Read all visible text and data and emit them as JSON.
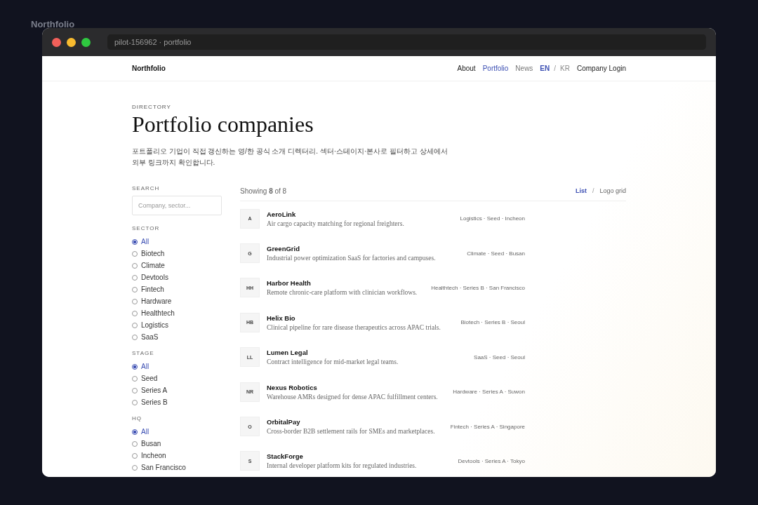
{
  "desktop_label": "Northfolio",
  "window": {
    "address": "pilot-156962 · portfolio"
  },
  "nav": {
    "brand": "Northfolio",
    "links": [
      {
        "label": "About",
        "selected": false
      },
      {
        "label": "Portfolio",
        "selected": true
      },
      {
        "label": "News",
        "selected": false
      }
    ],
    "languages": [
      {
        "label": "EN",
        "selected": true
      },
      {
        "label": "KR",
        "selected": false
      }
    ],
    "language_separator": "/",
    "login": "Company Login"
  },
  "header": {
    "eyebrow": "DIRECTORY",
    "title": "Portfolio companies",
    "description": "포트폴리오 기업이 직접 갱신하는 영/한 공식 소개 디렉터리. 섹터·스테이지·본사로 필터하고 상세에서 외부 링크까지 확인합니다."
  },
  "search": {
    "label": "SEARCH",
    "placeholder": "Company, sector..."
  },
  "filters": [
    {
      "label": "SECTOR",
      "options": [
        {
          "label": "All",
          "selected": true
        },
        {
          "label": "Biotech",
          "selected": false
        },
        {
          "label": "Climate",
          "selected": false
        },
        {
          "label": "Devtools",
          "selected": false
        },
        {
          "label": "Fintech",
          "selected": false
        },
        {
          "label": "Hardware",
          "selected": false
        },
        {
          "label": "Healthtech",
          "selected": false
        },
        {
          "label": "Logistics",
          "selected": false
        },
        {
          "label": "SaaS",
          "selected": false
        }
      ]
    },
    {
      "label": "STAGE",
      "options": [
        {
          "label": "All",
          "selected": true
        },
        {
          "label": "Seed",
          "selected": false
        },
        {
          "label": "Series A",
          "selected": false
        },
        {
          "label": "Series B",
          "selected": false
        }
      ]
    },
    {
      "label": "HQ",
      "options": [
        {
          "label": "All",
          "selected": true
        },
        {
          "label": "Busan",
          "selected": false
        },
        {
          "label": "Incheon",
          "selected": false
        },
        {
          "label": "San Francisco",
          "selected": false
        }
      ]
    }
  ],
  "results": {
    "summary": "Showing **8** of 8",
    "views": [
      {
        "label": "List",
        "selected": true
      },
      {
        "label": "Logo grid",
        "selected": false
      }
    ],
    "view_separator": "/"
  },
  "companies": [
    {
      "initials": "A",
      "name": "AeroLink",
      "description": "Air cargo capacity matching for regional freighters.",
      "meta": "Logistics · Seed · Incheon"
    },
    {
      "initials": "G",
      "name": "GreenGrid",
      "description": "Industrial power optimization SaaS for factories and campuses.",
      "meta": "Climate · Seed · Busan"
    },
    {
      "initials": "HH",
      "name": "Harbor Health",
      "description": "Remote chronic-care platform with clinician workflows.",
      "meta": "Healthtech · Series B · San Francisco"
    },
    {
      "initials": "HB",
      "name": "Helix Bio",
      "description": "Clinical pipeline for rare disease therapeutics across APAC trials.",
      "meta": "Biotech · Series B · Seoul"
    },
    {
      "initials": "LL",
      "name": "Lumen Legal",
      "description": "Contract intelligence for mid-market legal teams.",
      "meta": "SaaS · Seed · Seoul"
    },
    {
      "initials": "NR",
      "name": "Nexus Robotics",
      "description": "Warehouse AMRs designed for dense APAC fulfillment centers.",
      "meta": "Hardware · Series A · Suwon"
    },
    {
      "initials": "O",
      "name": "OrbitalPay",
      "description": "Cross-border B2B settlement rails for SMEs and marketplaces.",
      "meta": "Fintech · Series A · Singapore"
    },
    {
      "initials": "S",
      "name": "StackForge",
      "description": "Internal developer platform kits for regulated industries.",
      "meta": "Devtools · Series A · Tokyo"
    }
  ]
}
